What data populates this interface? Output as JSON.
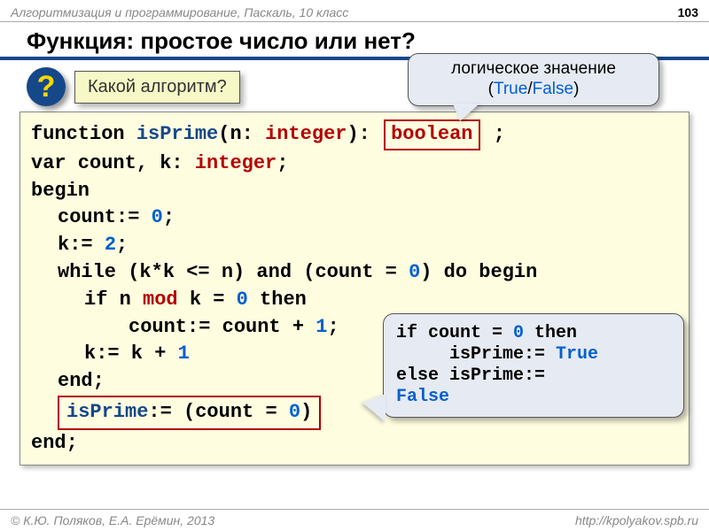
{
  "header": {
    "course": "Алгоритмизация и программирование, Паскаль, 10 класс",
    "page": "103"
  },
  "title": "Функция: простое число или нет?",
  "question": {
    "mark": "?",
    "text": "Какой алгоритм?"
  },
  "callout1": {
    "line1": "логическое значение",
    "paren_open": "(",
    "true": "True",
    "slash": "/",
    "false": "False",
    "paren_close": ")"
  },
  "code": {
    "l1": {
      "a": "function ",
      "fn": "isPrime",
      "b": "(n: ",
      "t1": "integer",
      "c": "):",
      "box": "boolean",
      "d": ";"
    },
    "l2": {
      "a": "var count, k: ",
      "t": "integer",
      "b": ";"
    },
    "l3": "begin",
    "l4": {
      "a": "count:= ",
      "n": "0",
      "b": ";"
    },
    "l5": {
      "a": "k:= ",
      "n": "2",
      "b": ";"
    },
    "l6": {
      "a": "while (k*k <= n) and (count = ",
      "n": "0",
      "b": ") do begin"
    },
    "l7": {
      "a": "if n ",
      "op": "mod",
      "b": " k = ",
      "n": "0",
      "c": " then"
    },
    "l8": {
      "a": "count:= count + ",
      "n": "1",
      "b": ";"
    },
    "l9": {
      "a": "k:= k + ",
      "n": "1"
    },
    "l10": "end;",
    "l11": {
      "fn": "isPrime",
      "a": ":= (count = ",
      "n": "0",
      "b": ")"
    },
    "l12": "end;"
  },
  "callout2": {
    "l1a": "if count = ",
    "l1n": "0",
    "l1b": " then",
    "l2a": "isPrime:= ",
    "l2t": "True",
    "l3a": "else isPrime:=",
    "l4": "False"
  },
  "footer": {
    "left": "© К.Ю. Поляков, Е.А. Ерёмин, 2013",
    "right": "http://kpolyakov.spb.ru"
  }
}
